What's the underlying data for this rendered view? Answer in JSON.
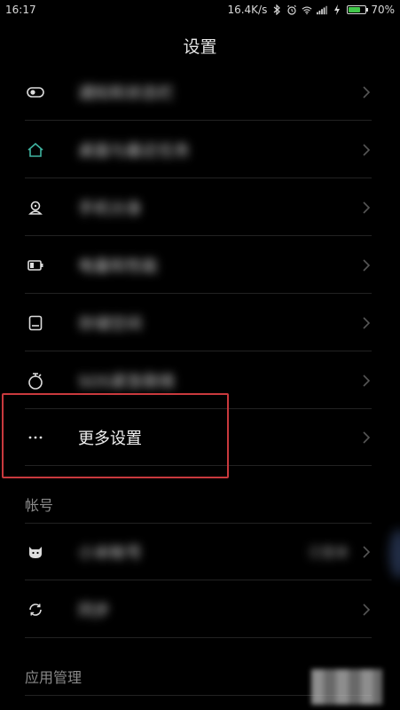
{
  "status_bar": {
    "time": "16:17",
    "network_speed": "16.4K/s",
    "battery_percent": "70%",
    "battery_level": 0.7,
    "icons": [
      "bluetooth-icon",
      "alarm-icon",
      "wifi-icon",
      "signal-icon",
      "charging-icon",
      "battery-icon"
    ]
  },
  "title": "设置",
  "rows": [
    {
      "name": "row-toggle-setting",
      "icon": "toggle-icon",
      "label": "通知和状态栏",
      "blurred": true
    },
    {
      "name": "row-desktop",
      "icon": "home-icon",
      "label": "桌面与最近任务",
      "blurred": true
    },
    {
      "name": "row-phone-lock",
      "icon": "lock-person-icon",
      "label": "手机分身",
      "blurred": true
    },
    {
      "name": "row-battery",
      "icon": "battery-outline-icon",
      "label": "电量和性能",
      "blurred": true
    },
    {
      "name": "row-storage",
      "icon": "storage-icon",
      "label": "存储空间",
      "blurred": true
    },
    {
      "name": "row-sos",
      "icon": "stopwatch-icon",
      "label": "SOS紧急联络",
      "blurred": true
    },
    {
      "name": "row-more-settings",
      "icon": "more-icon",
      "label": "更多设置",
      "blurred": false
    }
  ],
  "sections": [
    {
      "header": "帐号",
      "rows": [
        {
          "name": "row-mi-account",
          "icon": "mi-account-icon",
          "label": "小米帐号",
          "value": "已登录",
          "blurred": true
        },
        {
          "name": "row-sync",
          "icon": "sync-icon",
          "label": "同步",
          "blurred": true
        }
      ]
    },
    {
      "header": "应用管理",
      "rows": []
    }
  ],
  "colors": {
    "background": "#000000",
    "highlight": "#c9393d",
    "home_icon": "#3fb3a0",
    "battery_green": "#41c84a"
  }
}
